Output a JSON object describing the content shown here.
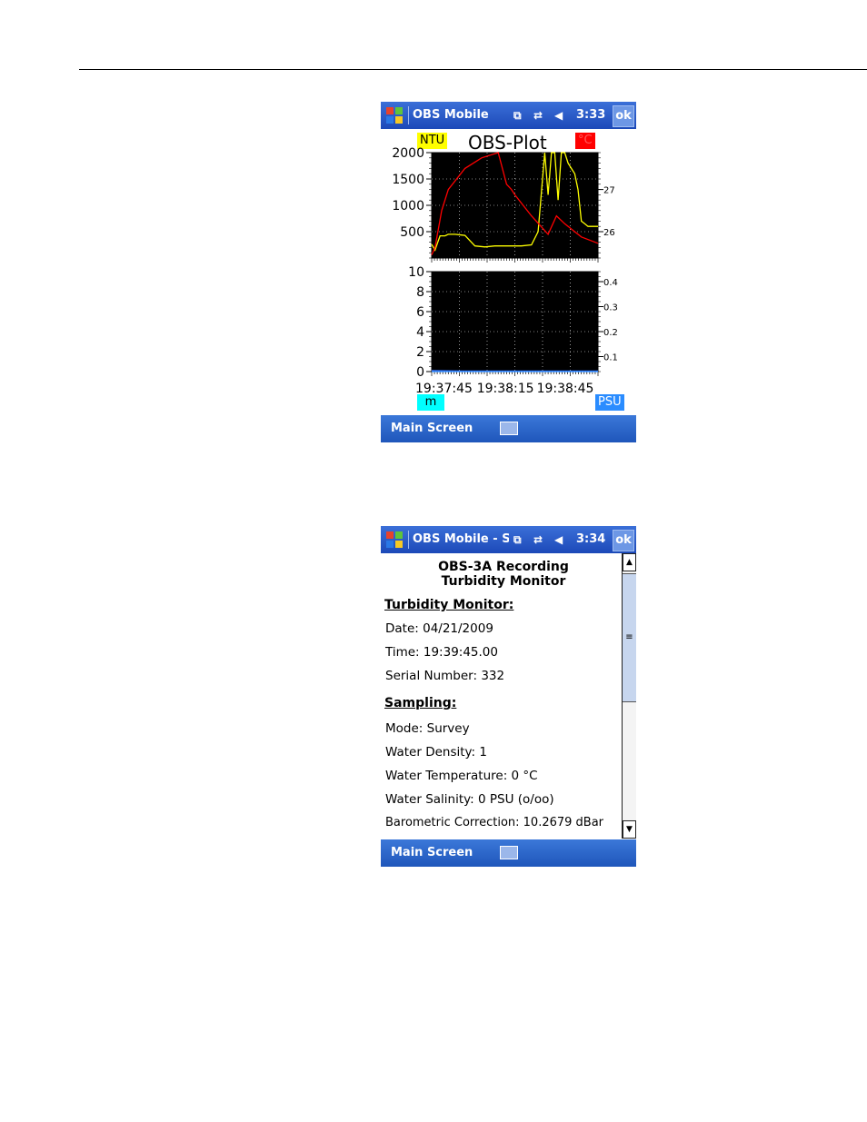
{
  "screen1": {
    "app_title": "OBS Mobile",
    "time": "3:33",
    "ok_label": "ok",
    "menu_label": "Main Screen",
    "plot_title": "OBS-Plot",
    "badge_ntu": "NTU",
    "badge_temp": "°C",
    "badge_depth": "m",
    "badge_salinity": "PSU",
    "colors": {
      "ntu": "#ffff00",
      "temp": "#ff0000",
      "depth": "#00ffff",
      "salinity": "#2a8cff"
    }
  },
  "chart_data": [
    {
      "type": "line",
      "title": "OBS-Plot",
      "x_ticks": [
        "19:37:45",
        "19:38:15",
        "19:38:45"
      ],
      "ylim_left": [
        0,
        2000
      ],
      "y_ticks_left": [
        "2000",
        "1500",
        "1000",
        "500"
      ],
      "y_ticks_right": [
        "27",
        "26"
      ],
      "grid": true,
      "series": [
        {
          "name": "NTU",
          "axis": "left",
          "color": "#ffff00",
          "x": [
            0,
            2,
            4,
            5,
            8,
            10,
            14,
            20,
            26,
            32,
            38,
            40,
            42,
            48,
            54,
            60,
            64,
            68,
            70,
            72,
            74,
            76,
            78,
            80,
            82,
            84,
            86,
            88,
            90,
            92,
            94,
            96,
            98,
            100
          ],
          "y": [
            260,
            150,
            330,
            420,
            420,
            450,
            450,
            430,
            230,
            210,
            230,
            230,
            230,
            230,
            230,
            250,
            500,
            2000,
            1200,
            2000,
            2000,
            1100,
            2000,
            2000,
            1800,
            1700,
            1600,
            1300,
            700,
            650,
            600,
            600,
            600,
            600
          ]
        },
        {
          "name": "°C",
          "axis": "right",
          "color": "#ff0000",
          "x": [
            0,
            2,
            6,
            10,
            20,
            30,
            40,
            45,
            48,
            50,
            60,
            70,
            75,
            80,
            90,
            100
          ],
          "y": [
            60,
            200,
            900,
            1300,
            1700,
            1900,
            2000,
            1400,
            1300,
            1200,
            800,
            450,
            800,
            650,
            400,
            280
          ]
        }
      ]
    },
    {
      "type": "line",
      "title": "",
      "x_ticks": [
        "19:37:45",
        "19:38:15",
        "19:38:45"
      ],
      "ylim_left": [
        0,
        10
      ],
      "y_ticks_left": [
        "10",
        "8",
        "6",
        "4",
        "2",
        "0"
      ],
      "y_ticks_right": [
        "0.4",
        "0.3",
        "0.2",
        "0.1"
      ],
      "grid": true,
      "series": [
        {
          "name": "m",
          "axis": "left",
          "color": "#3a73ff",
          "x": [
            0,
            20,
            40,
            60,
            80,
            100
          ],
          "y": [
            0.1,
            0.05,
            0.05,
            0.05,
            0.05,
            0.05
          ]
        },
        {
          "name": "PSU",
          "axis": "right",
          "color": "#2a8cff",
          "x": [
            0,
            100
          ],
          "y": [
            0,
            0
          ]
        }
      ]
    }
  ],
  "screen2": {
    "app_title": "OBS Mobile - Se",
    "time": "3:34",
    "ok_label": "ok",
    "menu_label": "Main Screen",
    "header_line1": "OBS-3A Recording",
    "header_line2": "Turbidity Monitor",
    "section1": "Turbidity Monitor:",
    "date": "Date: 04/21/2009",
    "time_value": "Time: 19:39:45.00",
    "serial": "Serial Number: 332",
    "section2": "Sampling:",
    "mode": "Mode: Survey",
    "density": "Water Density: 1",
    "temperature": "Water Temperature: 0 °C",
    "salinity": "Water Salinity: 0 PSU (o/oo)",
    "baro": "Barometric Correction: 10.2679 dBar"
  }
}
